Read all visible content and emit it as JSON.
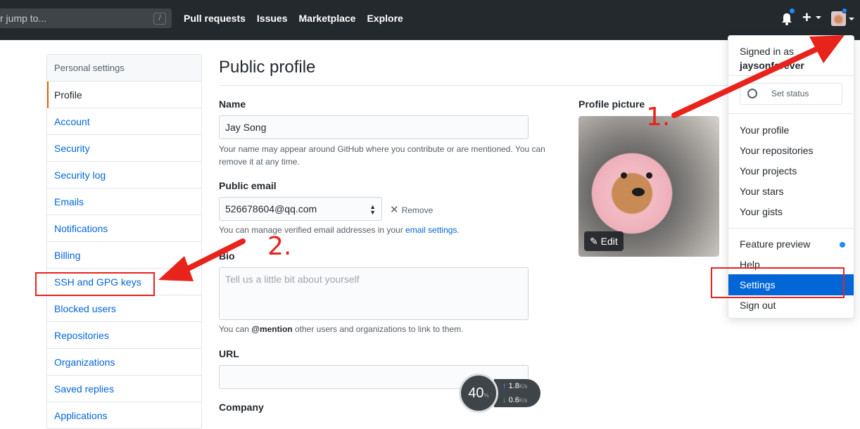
{
  "topbar": {
    "search_placeholder": "r jump to...",
    "search_shortcut": "/",
    "nav": [
      "Pull requests",
      "Issues",
      "Marketplace",
      "Explore"
    ],
    "plus": "+"
  },
  "sidebar": {
    "header": "Personal settings",
    "items": [
      "Profile",
      "Account",
      "Security",
      "Security log",
      "Emails",
      "Notifications",
      "Billing",
      "SSH and GPG keys",
      "Blocked users",
      "Repositories",
      "Organizations",
      "Saved replies",
      "Applications"
    ],
    "active": "Profile"
  },
  "main": {
    "title": "Public profile",
    "name_label": "Name",
    "name_value": "Jay Song",
    "name_note_line1": "Your name may appear around GitHub where you contribute or are mentioned. You can",
    "name_note_line2": "remove it at any time.",
    "email_label": "Public email",
    "email_value": "526678604@qq.com",
    "email_remove": "Remove",
    "email_note_prefix": "You can manage verified email addresses in your ",
    "email_note_link": "email settings",
    "email_note_suffix": ".",
    "bio_label": "Bio",
    "bio_placeholder": "Tell us a little bit about yourself",
    "bio_note_prefix": "You can ",
    "bio_note_mention": "@mention",
    "bio_note_suffix": " other users and organizations to link to them.",
    "url_label": "URL",
    "company_label": "Company",
    "picture_label": "Profile picture",
    "edit_label": "Edit"
  },
  "dropdown": {
    "signed_in_as": "Signed in as",
    "username": "jaysonforever",
    "set_status": "Set status",
    "profile_items": [
      "Your profile",
      "Your repositories",
      "Your projects",
      "Your stars",
      "Your gists"
    ],
    "feature_preview": "Feature preview",
    "help": "Help",
    "settings": "Settings",
    "sign_out": "Sign out"
  },
  "speed_widget": {
    "percent": "40",
    "percent_unit": "%",
    "up": "1.8",
    "down": "0.6",
    "unit": "K/s"
  },
  "annotations": {
    "step1": "1.",
    "step2": "2.",
    "color": "#e8231b"
  },
  "colors": {
    "topbar": "#24292e",
    "link": "#0366d6",
    "active_marker": "#e36209",
    "settings_highlight": "#0366d6"
  }
}
